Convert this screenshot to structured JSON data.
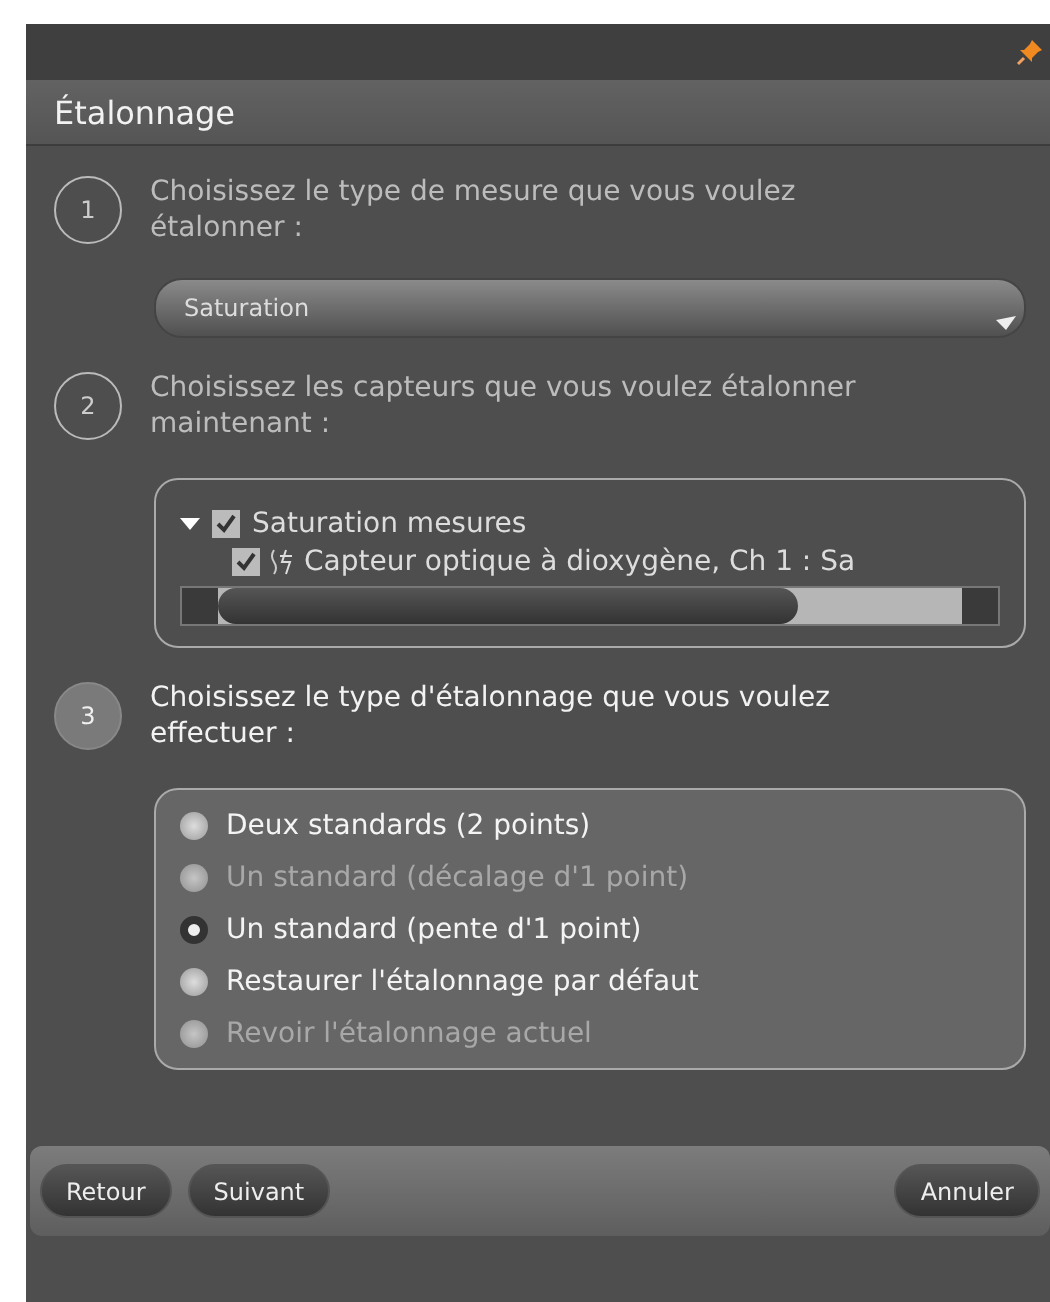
{
  "window": {
    "title": "Étalonnage"
  },
  "steps": [
    {
      "number": "1",
      "active": false,
      "text": "Choisissez le type de mesure que vous voulez étalonner :",
      "kind": "dropdown",
      "dropdown": {
        "value": "Saturation"
      }
    },
    {
      "number": "2",
      "active": false,
      "text": "Choisissez les capteurs que vous voulez étalonner maintenant :",
      "kind": "tree",
      "tree": [
        {
          "label": "Saturation mesures",
          "expanded": true,
          "checked": true,
          "children": [
            {
              "label": "Capteur optique à dioxygène, Ch 1 : Sa",
              "checked": true
            }
          ]
        }
      ]
    },
    {
      "number": "3",
      "active": true,
      "text": "Choisissez le type d'étalonnage que vous voulez effectuer :",
      "kind": "radios",
      "options": [
        {
          "label": "Deux standards (2 points)",
          "selected": false,
          "disabled": false
        },
        {
          "label": "Un standard (décalage d'1 point)",
          "selected": false,
          "disabled": true
        },
        {
          "label": "Un standard (pente d'1 point)",
          "selected": true,
          "disabled": false
        },
        {
          "label": "Restaurer l'étalonnage par défaut",
          "selected": false,
          "disabled": false
        },
        {
          "label": "Revoir l'étalonnage actuel",
          "selected": false,
          "disabled": true
        }
      ]
    }
  ],
  "buttons": {
    "left": [
      "Retour",
      "Suivant"
    ],
    "right": [
      "Annuler"
    ]
  }
}
